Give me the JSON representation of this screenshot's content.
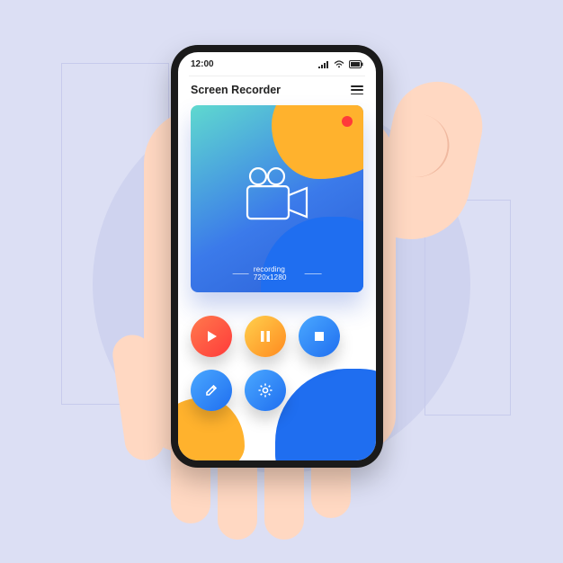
{
  "status_bar": {
    "time": "12:00"
  },
  "header": {
    "title": "Screen Recorder"
  },
  "preview": {
    "status_text": "recording 720x1280"
  },
  "icons": {
    "signal": "signal-icon",
    "wifi": "wifi-icon",
    "battery": "battery-icon",
    "menu": "hamburger-menu-icon",
    "camera": "video-camera-icon",
    "record_dot": "record-indicator-icon",
    "play": "play-icon",
    "pause": "pause-icon",
    "stop": "stop-icon",
    "edit": "pencil-icon",
    "settings": "gear-icon"
  },
  "colors": {
    "accent_blue": "#1f6ef0",
    "accent_orange": "#ffb22d",
    "record_red": "#ff3a3a"
  }
}
